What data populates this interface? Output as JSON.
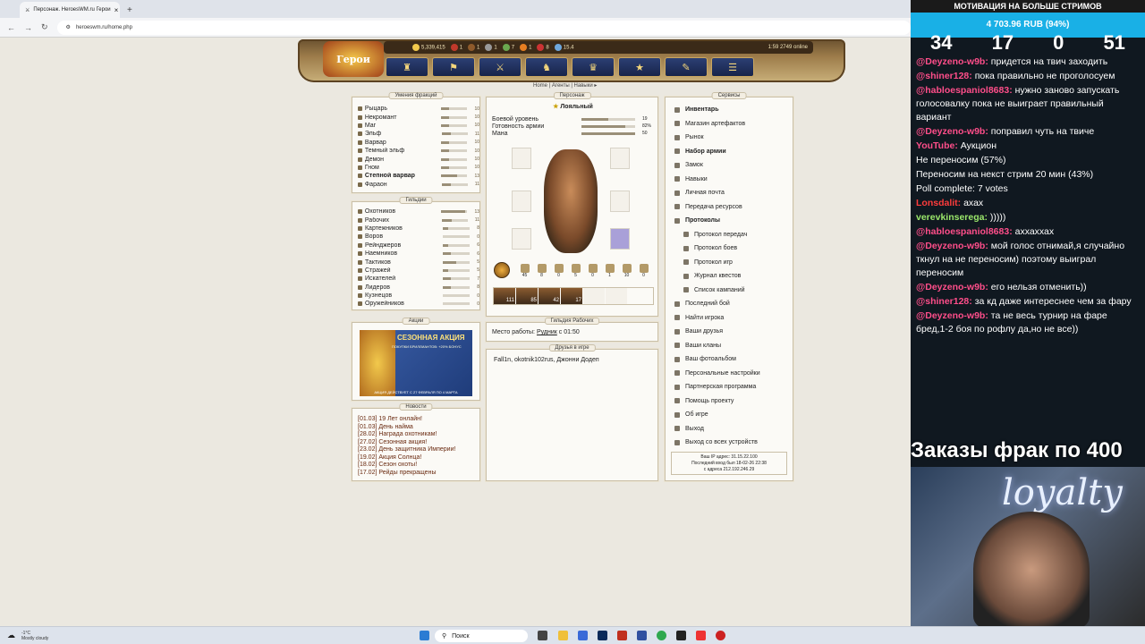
{
  "browser": {
    "tab_title": "Персонаж. HeroesWM.ru Герои",
    "url": "heroeswm.ru/home.php"
  },
  "header": {
    "logo_text": "Герои",
    "resources": [
      "5,339,415",
      "1",
      "1",
      "1",
      "7",
      "1",
      "8",
      "15.4"
    ],
    "online": "1:59  2749 online",
    "menu_icons": [
      "♜",
      "⚑",
      "⚔",
      "♞",
      "♛",
      "★",
      "✎",
      "☰"
    ]
  },
  "breadcrumb": "Home | Агенты | Навыки ▸",
  "factions": {
    "title": "Умения фракций",
    "items": [
      {
        "label": "Рыцарь",
        "val": "10",
        "fill": 0.3
      },
      {
        "label": "Некромант",
        "val": "10",
        "fill": 0.3
      },
      {
        "label": "Маг",
        "val": "10",
        "fill": 0.3
      },
      {
        "label": "Эльф",
        "val": "11",
        "fill": 0.35
      },
      {
        "label": "Варвар",
        "val": "10",
        "fill": 0.3
      },
      {
        "label": "Темный эльф",
        "val": "10",
        "fill": 0.3
      },
      {
        "label": "Демон",
        "val": "10",
        "fill": 0.3
      },
      {
        "label": "Гном",
        "val": "10",
        "fill": 0.3
      },
      {
        "label": "Степной варвар",
        "val": "13",
        "fill": 0.6
      },
      {
        "label": "Фараон",
        "val": "11",
        "fill": 0.35
      }
    ]
  },
  "guilds": {
    "title": "Гильдии",
    "items": [
      {
        "label": "Охотников",
        "val": "13",
        "fill": 0.9
      },
      {
        "label": "Рабочих",
        "val": "11",
        "fill": 0.4
      },
      {
        "label": "Картежников",
        "val": "8",
        "fill": 0.2
      },
      {
        "label": "Воров",
        "val": "0",
        "fill": 0
      },
      {
        "label": "Рейнджеров",
        "val": "6",
        "fill": 0.2
      },
      {
        "label": "Наемников",
        "val": "6",
        "fill": 0.3
      },
      {
        "label": "Тактиков",
        "val": "5",
        "fill": 0.5
      },
      {
        "label": "Стражей",
        "val": "5",
        "fill": 0.2
      },
      {
        "label": "Искателей",
        "val": "7",
        "fill": 0.3
      },
      {
        "label": "Лидеров",
        "val": "8",
        "fill": 0.3
      },
      {
        "label": "Кузнецов",
        "val": "0",
        "fill": 0
      },
      {
        "label": "Оружейников",
        "val": "0",
        "fill": 0
      }
    ]
  },
  "promo": {
    "title": "Акции",
    "banner_title": "СЕЗОННАЯ АКЦИЯ",
    "banner_sub": "ПОКУПКИ БРИЛЛИАНТОВ: +20% БОНУС",
    "banner_footer": "АКЦИЯ ДЕЙСТВУЕТ С 27 ФЕВРАЛЯ ПО 4 МАРТА"
  },
  "news": {
    "title": "Новости",
    "items": [
      "[01.03] 19 Лет онлайн!",
      "[01.03] День найма",
      "[28.02] Награда охотникам!",
      "[27.02] Сезонная акция!",
      "[23.02] День защитника Империи!",
      "[19.02] Акция Солнца!",
      "[18.02] Сезон охоты!",
      "[17.02] Рейды прекращены"
    ]
  },
  "character": {
    "title": "Персонаж",
    "status": "Лояльный",
    "stats": [
      {
        "label": "Боевой уровень",
        "val": "19",
        "fill": 0.5
      },
      {
        "label": "Готовность армии",
        "val": "82%",
        "fill": 0.82
      },
      {
        "label": "Мана",
        "val": "50",
        "fill": 1
      }
    ],
    "skill_values": [
      "45",
      "8",
      "0",
      "5",
      "0",
      "1",
      "10",
      "0"
    ],
    "units": [
      "111",
      "85",
      "42",
      "17",
      "",
      ""
    ]
  },
  "workers": {
    "title": "Гильдия Рабочих",
    "prefix": "Место работы:",
    "place": "Рудник",
    "suffix": "с 01:50"
  },
  "friends": {
    "title": "Друзья в игре",
    "list": "Fall1n, okotnik102rus, Джонни Додеп"
  },
  "services": {
    "title": "Сервисы",
    "items": [
      {
        "label": "Инвентарь",
        "bold": true,
        "sub": false
      },
      {
        "label": "Магазин артефактов",
        "bold": false,
        "sub": false
      },
      {
        "label": "Рынок",
        "bold": false,
        "sub": false
      },
      {
        "label": "Набор армии",
        "bold": true,
        "sub": false
      },
      {
        "label": "Замок",
        "bold": false,
        "sub": false
      },
      {
        "label": "Навыки",
        "bold": false,
        "sub": false
      },
      {
        "label": "Личная почта",
        "bold": false,
        "sub": false
      },
      {
        "label": "Передача ресурсов",
        "bold": false,
        "sub": false
      },
      {
        "label": "Протоколы",
        "bold": true,
        "sub": false
      },
      {
        "label": "Протокол передач",
        "bold": false,
        "sub": true
      },
      {
        "label": "Протокол боев",
        "bold": false,
        "sub": true
      },
      {
        "label": "Протокол игр",
        "bold": false,
        "sub": true
      },
      {
        "label": "Журнал квестов",
        "bold": false,
        "sub": true
      },
      {
        "label": "Список кампаний",
        "bold": false,
        "sub": true
      },
      {
        "label": "Последний бой",
        "bold": false,
        "sub": false
      },
      {
        "label": "Найти игрока",
        "bold": false,
        "sub": false
      },
      {
        "label": "Ваши друзья",
        "bold": false,
        "sub": false
      },
      {
        "label": "Ваши кланы",
        "bold": false,
        "sub": false
      },
      {
        "label": "Ваш фотоальбом",
        "bold": false,
        "sub": false
      },
      {
        "label": "Персональные настройки",
        "bold": false,
        "sub": false
      },
      {
        "label": "Партнерская программа",
        "bold": false,
        "sub": false
      },
      {
        "label": "Помощь проекту",
        "bold": false,
        "sub": false
      },
      {
        "label": "Об игре",
        "bold": false,
        "sub": false
      },
      {
        "label": "Выход",
        "bold": false,
        "sub": false
      },
      {
        "label": "Выход со всех устройств",
        "bold": false,
        "sub": false
      }
    ],
    "ip_line1": "Ваш IP адрес: 31.15.22.100",
    "ip_line2": "Последний вход был 18-02-26 22:38",
    "ip_line3": "с адреса 212.192.246.29"
  },
  "stream": {
    "motivation": "МОТИВАЦИЯ НА БОЛЬШЕ СТРИМОВ",
    "goal": "4 703.96 RUB (94%)",
    "counters": [
      "34",
      "17",
      "0",
      "51"
    ],
    "chat": [
      {
        "user": "@Deyzeno-w9b:",
        "text": "придется на твич заходить",
        "cls": "u"
      },
      {
        "user": "@shiner128:",
        "text": "пока правильно не проголосуем",
        "cls": "u"
      },
      {
        "user": "@habloespaniol8683:",
        "text": "нужно заново запускать голосовалку пока не выиграет правильный вариант",
        "cls": "u"
      },
      {
        "user": "@Deyzeno-w9b:",
        "text": "поправил чуть на твиче",
        "cls": "u"
      },
      {
        "user": "YouTube:",
        "text": "Аукцион",
        "cls": "u"
      },
      {
        "user": "",
        "text": "Не переносим (57%)",
        "cls": "u"
      },
      {
        "user": "",
        "text": "Переносим на некст стрим 20 мин (43%)",
        "cls": "u"
      },
      {
        "user": "",
        "text": "Poll complete: 7 votes",
        "cls": "u"
      },
      {
        "user": "Lonsdalit:",
        "text": "ахах",
        "cls": "u3"
      },
      {
        "user": "verevkinserega:",
        "text": ")))))",
        "cls": "u2"
      },
      {
        "user": "@habloespaniol8683:",
        "text": "аххаххах",
        "cls": "u"
      },
      {
        "user": "@Deyzeno-w9b:",
        "text": "мой голос отнимай,я случайно ткнул на не переносим) поэтому выиграл переносим",
        "cls": "u"
      },
      {
        "user": "@Deyzeno-w9b:",
        "text": "его нельзя отменить))",
        "cls": "u"
      },
      {
        "user": "@shiner128:",
        "text": "за кд даже интереснее чем за фару",
        "cls": "u"
      },
      {
        "user": "@Deyzeno-w9b:",
        "text": "та не весь турнир на фаре бред,1-2 боя по рофлу да,но не все))",
        "cls": "u"
      }
    ],
    "ticker": "Заказы фрак по 400",
    "neon": "loyalty"
  },
  "taskbar": {
    "weather_temp": "-1°C",
    "weather_desc": "Mostly cloudy",
    "search_placeholder": "Поиск"
  }
}
